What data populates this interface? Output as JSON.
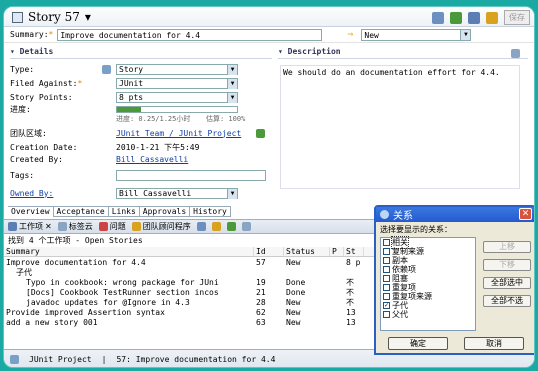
{
  "editor": {
    "title": "Story 57",
    "save_label": "保存",
    "summary_label": "Summary:",
    "summary_value": "Improve documentation for 4.4",
    "status_value": "New",
    "details_header": "Details",
    "description_header": "Description",
    "description_text": "We should do an documentation effort for 4.4.",
    "fields": [
      {
        "label": "Type:",
        "value": "Story"
      },
      {
        "label": "Filed Against:",
        "value": "JUnit"
      },
      {
        "label": "Story Points:",
        "value": "8 pts"
      },
      {
        "label": "进度:",
        "value": ""
      },
      {
        "label": "团队区域:",
        "value": "JUnit Team / JUnit Project"
      },
      {
        "label": "Creation Date:",
        "value": "2010-1-21 下午5:49"
      },
      {
        "label": "Created By:",
        "value": "Bill Cassavelli"
      },
      {
        "label": "Tags:",
        "value": ""
      },
      {
        "label": "Owned By:",
        "value": "Bill Cassavelli"
      }
    ],
    "progress_text": "进度: 0.25/1.25小时",
    "estimate_text": "估算: 100%",
    "progress_fraction": 0.2,
    "tabs": [
      "Overview",
      "Acceptance",
      "Links",
      "Approvals",
      "History"
    ]
  },
  "bottom": {
    "tabs": [
      "工作项",
      "标签云",
      "问题",
      "团队顾问程序"
    ],
    "found_text": "找到 4 个工作项 - Open Stories",
    "columns": [
      "Summary",
      "Id",
      "Status",
      "P",
      "St"
    ],
    "rows": [
      {
        "summary": "Improve documentation for 4.4",
        "id": "57",
        "status": "New",
        "p": "",
        "st": "8 p"
      },
      {
        "summary": "子代",
        "id": "",
        "status": "",
        "p": "",
        "st": ""
      },
      {
        "summary": "Typo in cookbook: wrong package for JUni",
        "id": "19",
        "status": "Done",
        "p": "",
        "st": "不"
      },
      {
        "summary": "[Docs] Cookbook TestRunner section incos",
        "id": "21",
        "status": "Done",
        "p": "",
        "st": "不"
      },
      {
        "summary": "javadoc updates for @Ignore in 4.3",
        "id": "28",
        "status": "New",
        "p": "",
        "st": "不"
      },
      {
        "summary": "Provide improved Assertion syntax",
        "id": "62",
        "status": "New",
        "p": "",
        "st": "13"
      },
      {
        "summary": "add a new story 001",
        "id": "63",
        "status": "New",
        "p": "",
        "st": "13"
      }
    ]
  },
  "statusbar": {
    "project": "JUnit Project",
    "item": "57: Improve documentation for 4.4"
  },
  "dialog": {
    "title": "关系",
    "prompt": "选择要显示的关系：",
    "items": [
      {
        "label": "相关",
        "checked": false
      },
      {
        "label": "复制来源",
        "checked": false
      },
      {
        "label": "副本",
        "checked": false
      },
      {
        "label": "依赖项",
        "checked": false
      },
      {
        "label": "阻塞",
        "checked": false
      },
      {
        "label": "重复项",
        "checked": false
      },
      {
        "label": "重复项来源",
        "checked": false
      },
      {
        "label": "子代",
        "checked": true
      },
      {
        "label": "父代",
        "checked": false
      }
    ],
    "up_label": "上移",
    "down_label": "下移",
    "select_all_label": "全部选中",
    "deselect_all_label": "全部不选",
    "ok_label": "确定",
    "cancel_label": "取消"
  }
}
